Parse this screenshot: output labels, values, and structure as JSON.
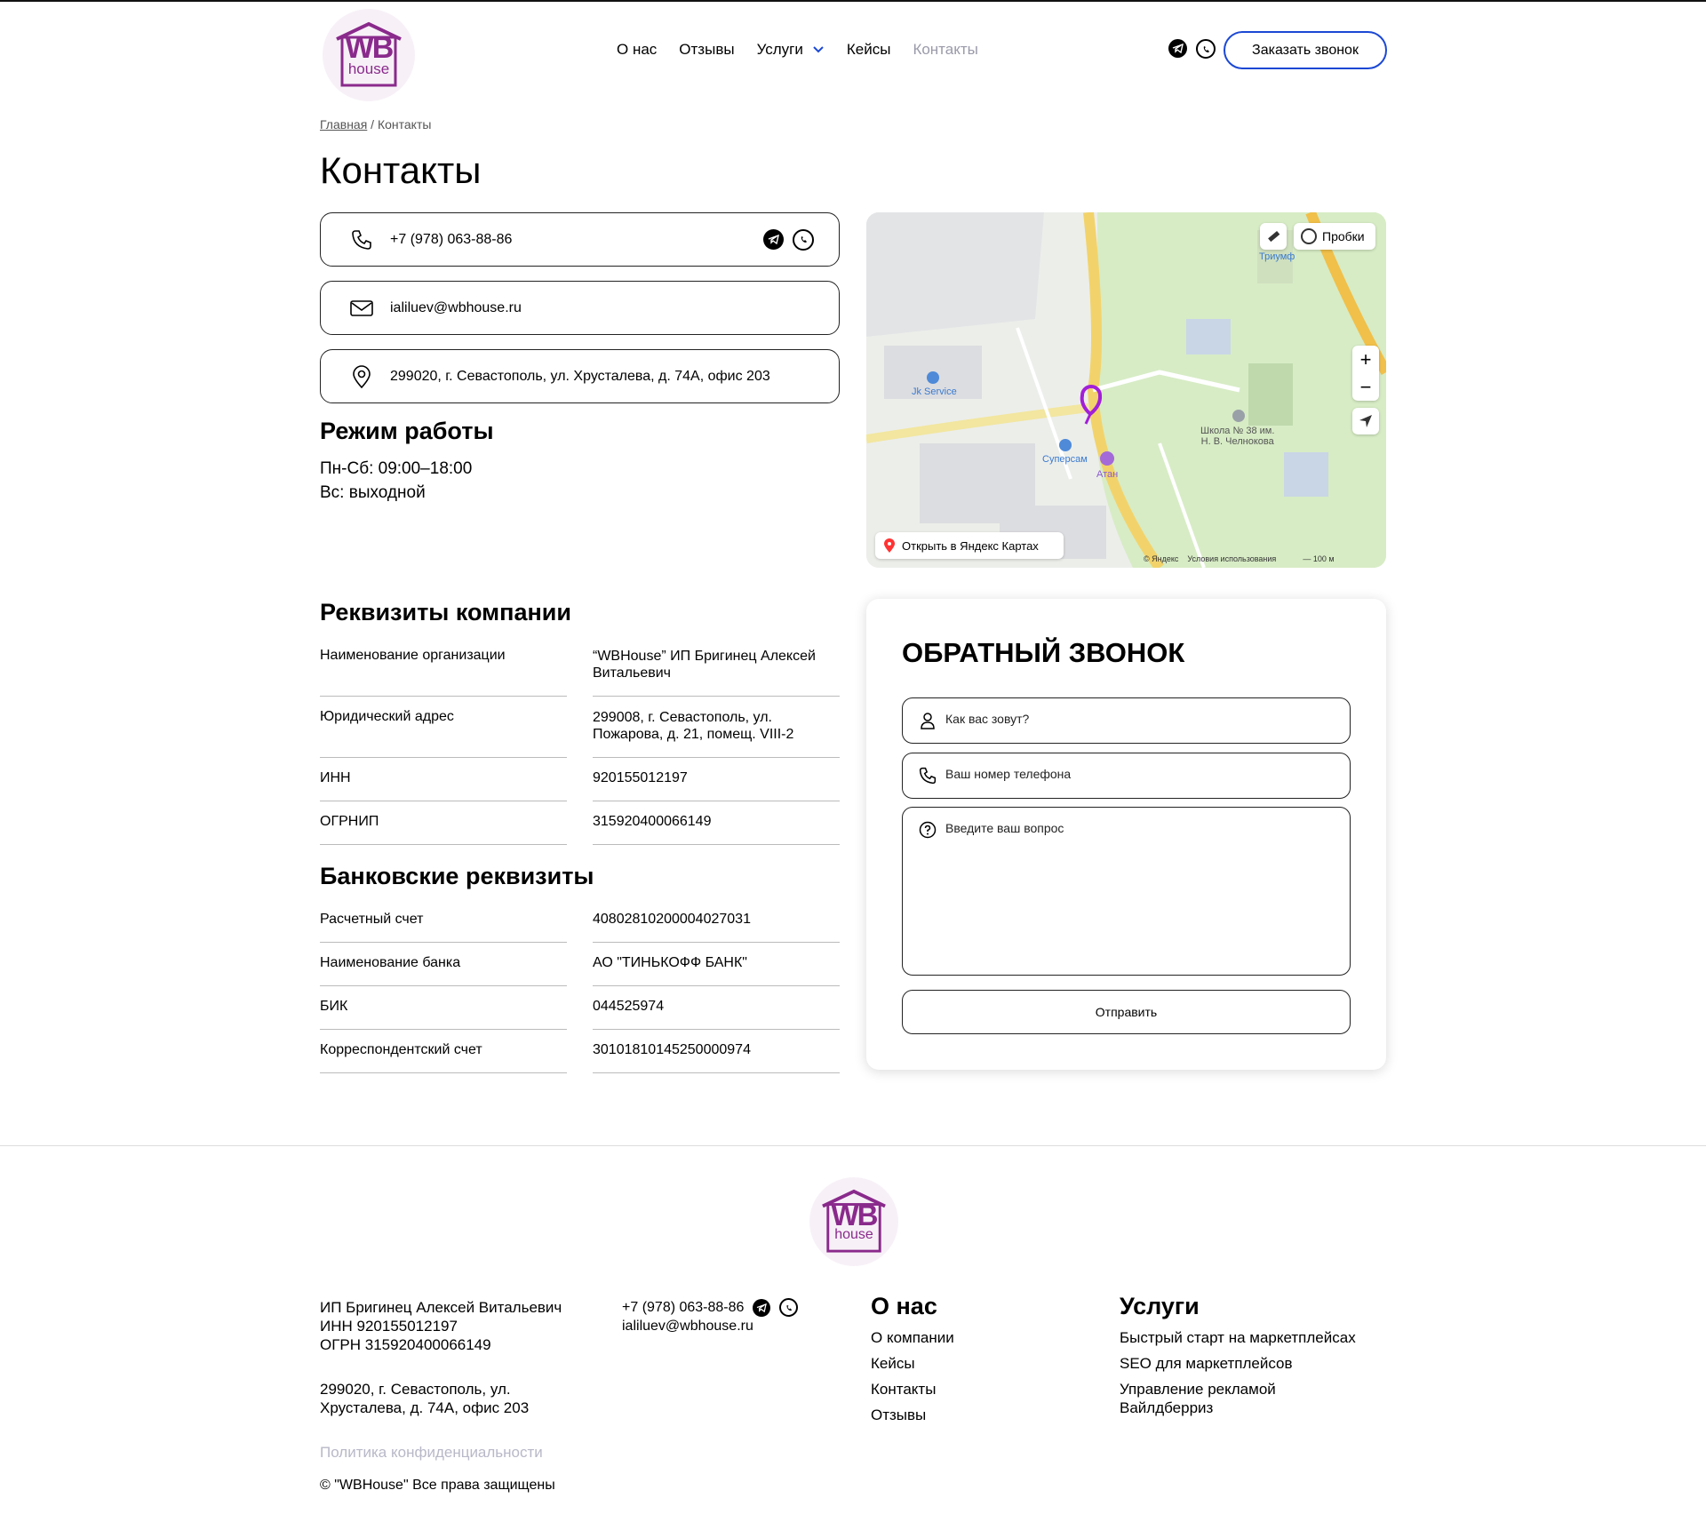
{
  "header": {
    "logo": {
      "wb": "WB",
      "house": "house"
    },
    "nav": [
      {
        "label": "О нас"
      },
      {
        "label": "Отзывы"
      },
      {
        "label": "Услуги"
      },
      {
        "label": "Кейсы"
      },
      {
        "label": "Контакты"
      }
    ],
    "active_nav": "Контакты",
    "call_button": "Заказать звонок"
  },
  "breadcrumb": {
    "home": "Главная",
    "sep": " / ",
    "current": "Контакты"
  },
  "title": "Контакты",
  "contacts": {
    "phone": "+7 (978) 063-88-86",
    "email": "ialiluev@wbhouse.ru",
    "address": "299020, г. Севастополь, ул. Хрусталева, д. 74А, офис 203"
  },
  "hours": {
    "title": "Режим работы",
    "line1": "Пн-Сб: 09:00–18:00",
    "line2": "Вс: выходной"
  },
  "map": {
    "traffic": "Пробки",
    "open_link": "Открыть в Яндекс Картах",
    "copyright": "© Яндекс",
    "terms": "Условия использования",
    "scale": "100 м",
    "labels": {
      "jk": "Jk Service",
      "supersam": "Суперсам",
      "atan": "Атан",
      "school": "Школа № 38 им.",
      "school2": "Н. В. Челнокова",
      "triumf": "Триумф"
    }
  },
  "requisites": {
    "title": "Реквизиты компании",
    "rows": [
      {
        "k": "Наименование организации",
        "v": "“WBHouse” ИП Бригинец Алексей Витальевич"
      },
      {
        "k": "Юридический адрес",
        "v": "299008, г. Севастополь, ул. Пожарова, д. 21, помещ. VIII-2"
      },
      {
        "k": "ИНН",
        "v": "920155012197"
      },
      {
        "k": "ОГРНИП",
        "v": "315920400066149"
      }
    ]
  },
  "bank": {
    "title": "Банковские реквизиты",
    "rows": [
      {
        "k": "Расчетный счет",
        "v": "40802810200004027031"
      },
      {
        "k": "Наименование банка",
        "v": "АО \"ТИНЬКОФФ БАНК\""
      },
      {
        "k": "БИК",
        "v": "044525974"
      },
      {
        "k": "Корреспондентский счет",
        "v": "30101810145250000974"
      }
    ]
  },
  "form": {
    "title": "ОБРАТНЫЙ ЗВОНОК",
    "name_ph": "Как вас зовут?",
    "phone_ph": "Ваш номер телефона",
    "question_ph": "Введите ваш вопрос",
    "submit": "Отправить"
  },
  "footer": {
    "company": "ИП Бригинец Алексей Витальевич",
    "inn": "ИНН 920155012197",
    "ogrn": "ОГРН 315920400066149",
    "address1": "299020, г. Севастополь, ул.",
    "address2": "Хрусталева, д. 74А, офис 203",
    "policy": "Политика конфиденциальности",
    "copyright": "© \"WBHouse\" Все права защищены",
    "phone": "+7 (978) 063-88-86",
    "email": "ialiluev@wbhouse.ru",
    "about_title": "О нас",
    "about": [
      "О компании",
      "Кейсы",
      "Контакты",
      "Отзывы"
    ],
    "services_title": "Услуги",
    "services": [
      "Быстрый старт на маркетплейсах",
      "SEO для маркетплейсов",
      "Управление рекламой Вайлдберриз"
    ]
  },
  "colors": {
    "accent": "#1b48d4",
    "brand": "#8a2a8c",
    "muted": "#b8b8c8"
  }
}
